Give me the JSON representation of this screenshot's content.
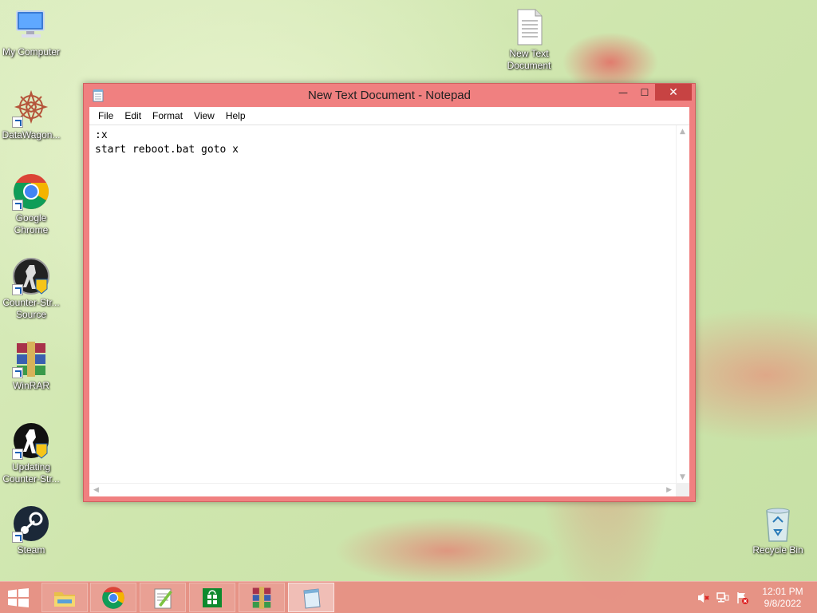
{
  "desktop": {
    "icons": [
      {
        "label": "My Computer"
      },
      {
        "label": "DataWagon..."
      },
      {
        "label": "Google Chrome"
      },
      {
        "label": "Counter-Str... Source"
      },
      {
        "label": "WinRAR"
      },
      {
        "label": "Updating Counter-Str..."
      },
      {
        "label": "Steam"
      },
      {
        "label": "New Text Document"
      },
      {
        "label": "Recycle Bin"
      }
    ]
  },
  "notepad": {
    "title": "New Text Document - Notepad",
    "menu": [
      "File",
      "Edit",
      "Format",
      "View",
      "Help"
    ],
    "content": ":x\nstart reboot.bat goto x",
    "buttons": {
      "minimize": "—",
      "maximize": "☐",
      "close": "✕"
    }
  },
  "taskbar": {
    "items": [
      "file-explorer",
      "google-chrome",
      "notepad-plus-plus",
      "windows-store",
      "winrar",
      "notepad"
    ],
    "active": "notepad",
    "clock": {
      "time": "12:01 PM",
      "date": "9/8/2022"
    }
  },
  "colors": {
    "window_frame": "#f08080",
    "close_button": "#c74343",
    "taskbar": "#e88c82"
  }
}
